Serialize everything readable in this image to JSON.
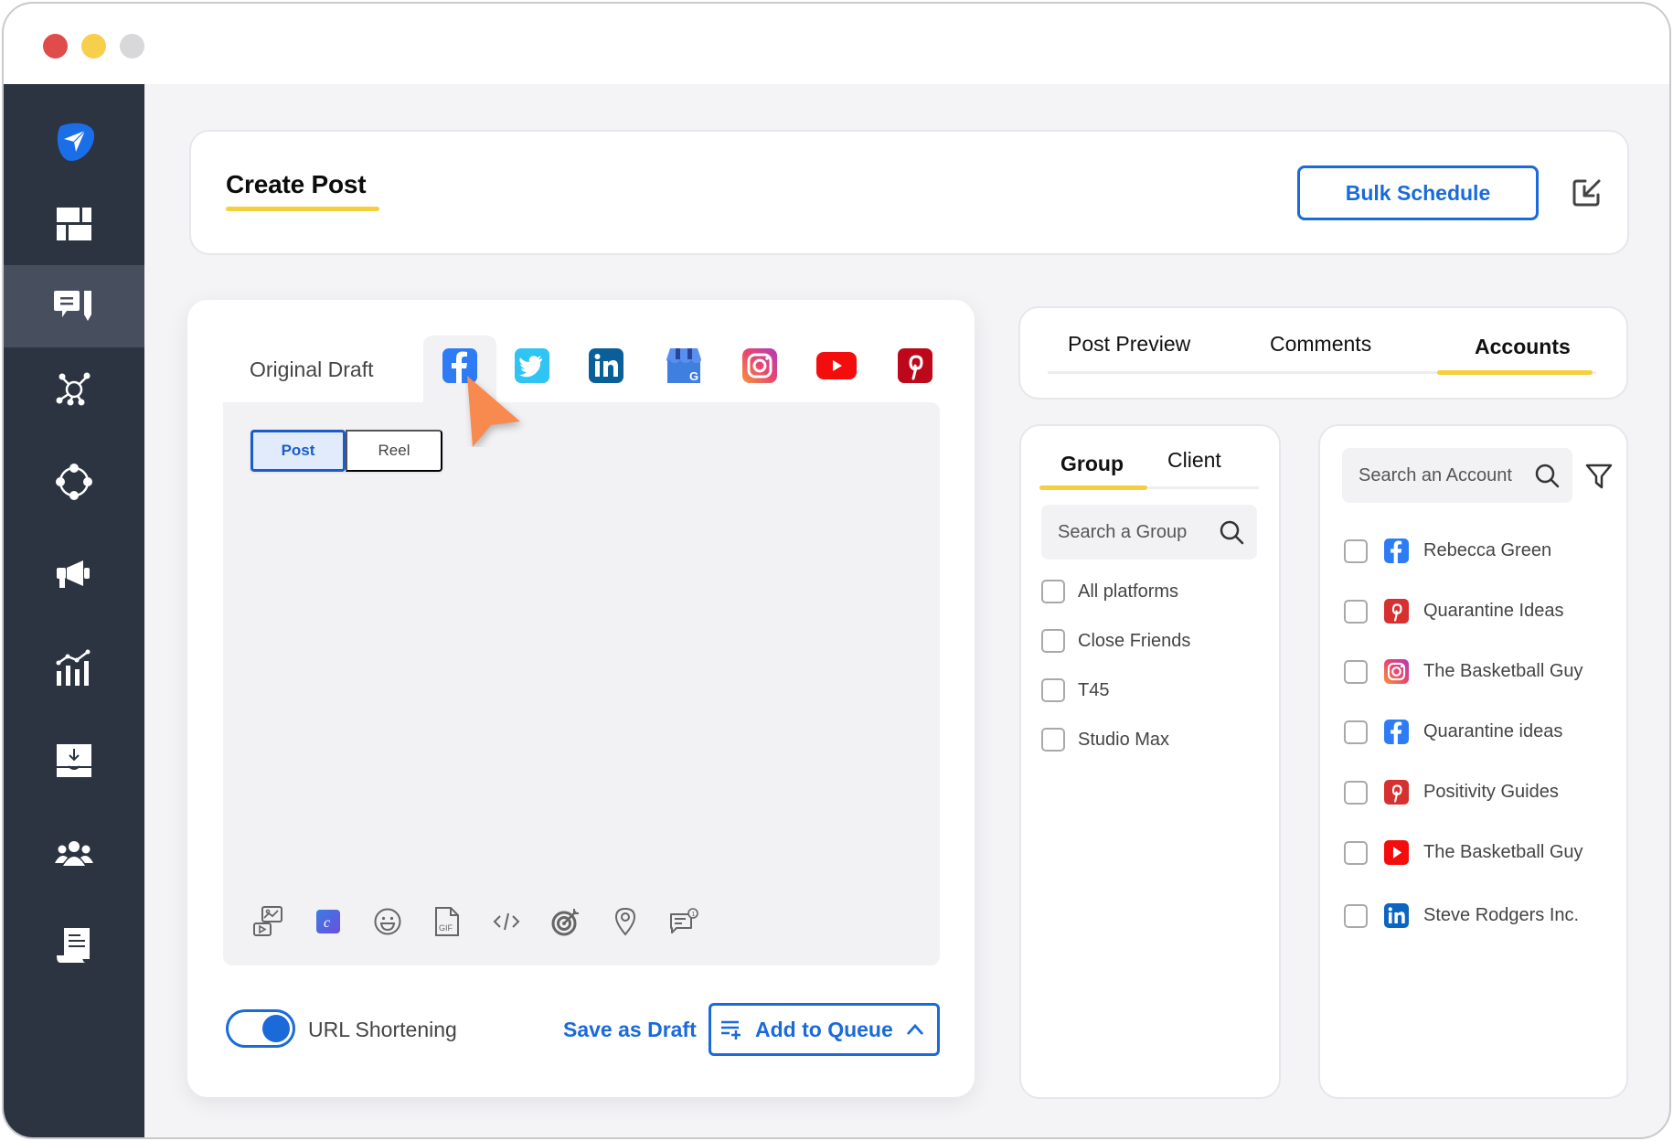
{
  "window": {
    "controls": [
      "close",
      "minimize",
      "zoom"
    ]
  },
  "sidebar": {
    "items": [
      {
        "name": "logo",
        "icon": "paper-plane-logo-icon",
        "active": false
      },
      {
        "name": "dashboard",
        "icon": "dashboard-grid-icon",
        "active": false
      },
      {
        "name": "create-post",
        "icon": "compose-post-icon",
        "active": true
      },
      {
        "name": "network",
        "icon": "network-hub-icon",
        "active": false
      },
      {
        "name": "connections",
        "icon": "circle-nodes-icon",
        "active": false
      },
      {
        "name": "campaigns",
        "icon": "megaphone-icon",
        "active": false
      },
      {
        "name": "analytics",
        "icon": "analytics-chart-icon",
        "active": false
      },
      {
        "name": "inbox",
        "icon": "inbox-download-icon",
        "active": false
      },
      {
        "name": "team",
        "icon": "team-users-icon",
        "active": false
      },
      {
        "name": "reports",
        "icon": "report-scroll-icon",
        "active": false
      }
    ]
  },
  "header": {
    "title": "Create Post",
    "bulk_schedule_label": "Bulk Schedule",
    "accent": "#f6cf3d",
    "primary": "#1a6ad9"
  },
  "editor": {
    "original_draft_label": "Original Draft",
    "social_tabs": [
      {
        "name": "facebook",
        "active": true
      },
      {
        "name": "twitter",
        "active": false
      },
      {
        "name": "linkedin",
        "active": false
      },
      {
        "name": "google-business",
        "active": false
      },
      {
        "name": "instagram",
        "active": false
      },
      {
        "name": "youtube",
        "active": false
      },
      {
        "name": "pinterest",
        "active": false
      }
    ],
    "post_type": {
      "options": [
        "Post",
        "Reel"
      ],
      "selected": "Post"
    },
    "toolbar": [
      "media",
      "canva",
      "emoji",
      "gif",
      "code",
      "target",
      "location",
      "first-comment"
    ],
    "url_shortening_label": "URL Shortening",
    "url_shortening_on": true,
    "save_draft_label": "Save as Draft",
    "add_to_queue_label": "Add to Queue"
  },
  "right_tabs": {
    "items": [
      "Post Preview",
      "Comments",
      "Accounts"
    ],
    "active": "Accounts"
  },
  "group_panel": {
    "tabs": [
      "Group",
      "Client"
    ],
    "active": "Group",
    "search_placeholder": "Search a Group",
    "groups": [
      {
        "label": "All platforms",
        "checked": false
      },
      {
        "label": "Close Friends",
        "checked": false
      },
      {
        "label": "T45",
        "checked": false
      },
      {
        "label": "Studio Max",
        "checked": false
      }
    ]
  },
  "accounts_panel": {
    "search_placeholder": "Search an Account",
    "accounts": [
      {
        "label": "Rebecca Green",
        "platform": "facebook",
        "checked": false
      },
      {
        "label": "Quarantine Ideas",
        "platform": "pinterest",
        "checked": false
      },
      {
        "label": "The Basketball Guy",
        "platform": "instagram",
        "checked": false
      },
      {
        "label": "Quarantine ideas",
        "platform": "facebook",
        "checked": false
      },
      {
        "label": "Positivity Guides",
        "platform": "pinterest",
        "checked": false
      },
      {
        "label": "The Basketball Guy",
        "platform": "youtube",
        "checked": false
      },
      {
        "label": "Steve Rodgers Inc.",
        "platform": "linkedin",
        "checked": false
      }
    ]
  }
}
